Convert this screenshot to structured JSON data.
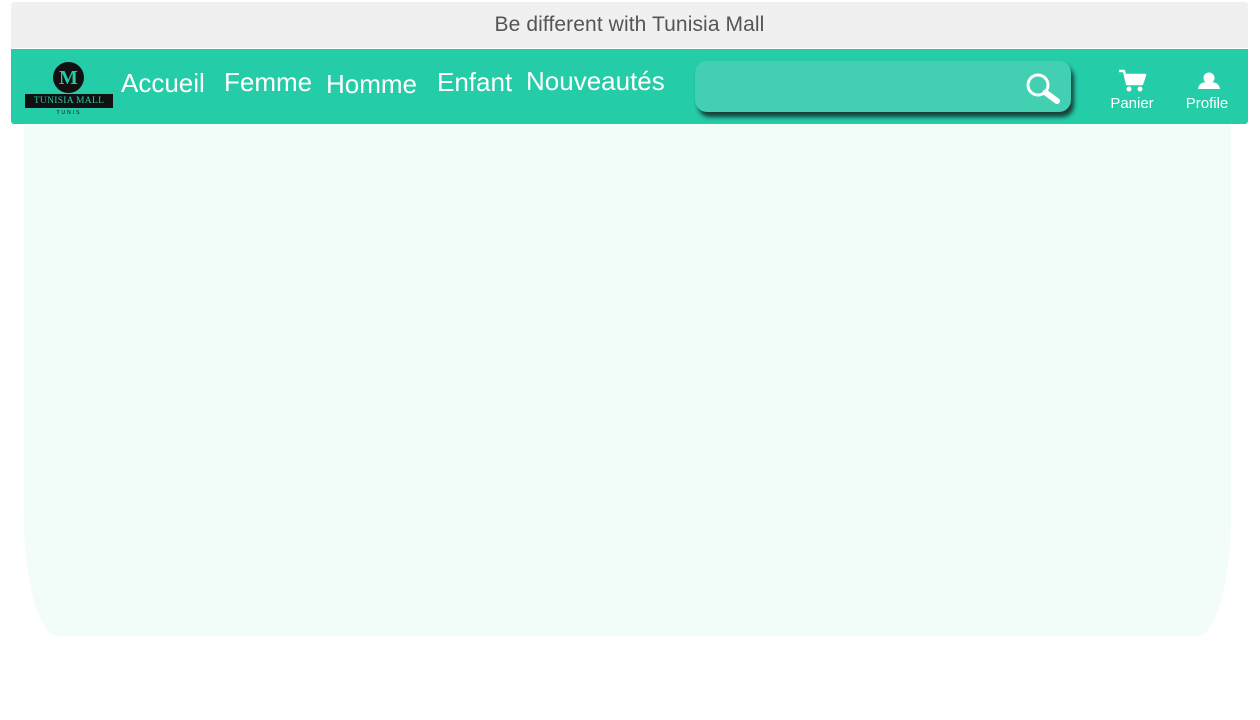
{
  "promo": {
    "text": "Be different with Tunisia Mall"
  },
  "logo": {
    "monogram": "M",
    "name": "TUNISIA MALL",
    "city": "TUNIS"
  },
  "nav": {
    "links": [
      "Accueil",
      "Femme",
      "Homme",
      "Enfant",
      "Nouveautés"
    ]
  },
  "search": {
    "value": "",
    "placeholder": ""
  },
  "actions": {
    "cart_label": "Panier",
    "profile_label": "Profile"
  },
  "colors": {
    "nav_background": "#24cca8",
    "search_background": "#42cfb2",
    "promo_background": "#f0f0f0",
    "content_background": "#f2fcf9",
    "logo_dark": "#111111"
  },
  "icons": {
    "search": "magnifier-icon",
    "cart": "shopping-cart-icon",
    "profile": "user-icon"
  }
}
